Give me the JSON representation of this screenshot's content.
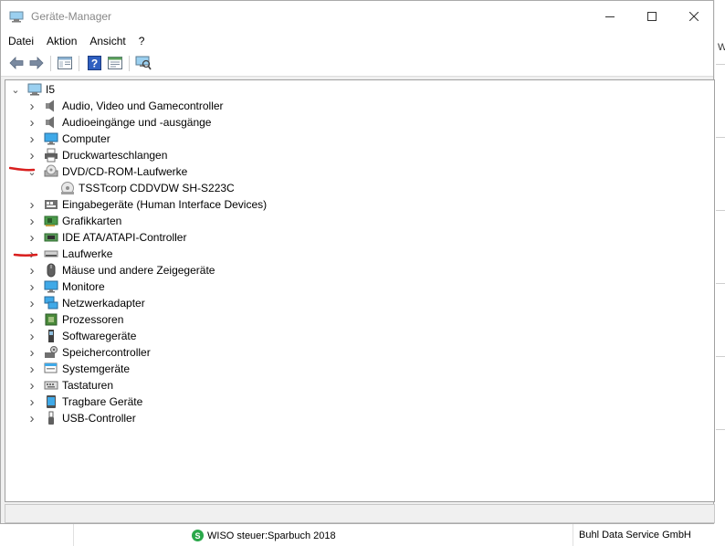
{
  "window": {
    "title": "Geräte-Manager"
  },
  "menu": {
    "items": [
      "Datei",
      "Aktion",
      "Ansicht",
      "?"
    ]
  },
  "tree": {
    "root": "I5",
    "categories": [
      {
        "label": "Audio, Video und Gamecontroller",
        "icon": "speaker-icon",
        "expanded": false
      },
      {
        "label": "Audioeingänge und -ausgänge",
        "icon": "speaker-icon",
        "expanded": false
      },
      {
        "label": "Computer",
        "icon": "monitor-icon",
        "expanded": false
      },
      {
        "label": "Druckwarteschlangen",
        "icon": "printer-icon",
        "expanded": false
      },
      {
        "label": "DVD/CD-ROM-Laufwerke",
        "icon": "dvd-drive-icon",
        "expanded": true
      },
      {
        "label": "Eingabegeräte (Human Interface Devices)",
        "icon": "hid-icon",
        "expanded": false
      },
      {
        "label": "Grafikkarten",
        "icon": "graphics-card-icon",
        "expanded": false
      },
      {
        "label": "IDE ATA/ATAPI-Controller",
        "icon": "ide-controller-icon",
        "expanded": false
      },
      {
        "label": "Laufwerke",
        "icon": "disk-drive-icon",
        "expanded": false
      },
      {
        "label": "Mäuse und andere Zeigegeräte",
        "icon": "mouse-icon",
        "expanded": false
      },
      {
        "label": "Monitore",
        "icon": "monitor-icon",
        "expanded": false
      },
      {
        "label": "Netzwerkadapter",
        "icon": "network-adapter-icon",
        "expanded": false
      },
      {
        "label": "Prozessoren",
        "icon": "processor-icon",
        "expanded": false
      },
      {
        "label": "Softwaregeräte",
        "icon": "software-device-icon",
        "expanded": false
      },
      {
        "label": "Speichercontroller",
        "icon": "storage-controller-icon",
        "expanded": false
      },
      {
        "label": "Systemgeräte",
        "icon": "system-device-icon",
        "expanded": false
      },
      {
        "label": "Tastaturen",
        "icon": "keyboard-icon",
        "expanded": false
      },
      {
        "label": "Tragbare Geräte",
        "icon": "portable-device-icon",
        "expanded": false
      },
      {
        "label": "USB-Controller",
        "icon": "usb-icon",
        "expanded": false
      }
    ],
    "dvd_child": "TSSTcorp CDDVDW SH-S223C"
  },
  "background": {
    "row_name": "WISO steuer:Sparbuch 2018",
    "row_icon_letter": "S",
    "row_publisher": "Buhl Data Service GmbH",
    "right_edge_text": "W"
  },
  "colors": {
    "annotation": "#d9201f",
    "selected_row": "#cce8ff"
  }
}
